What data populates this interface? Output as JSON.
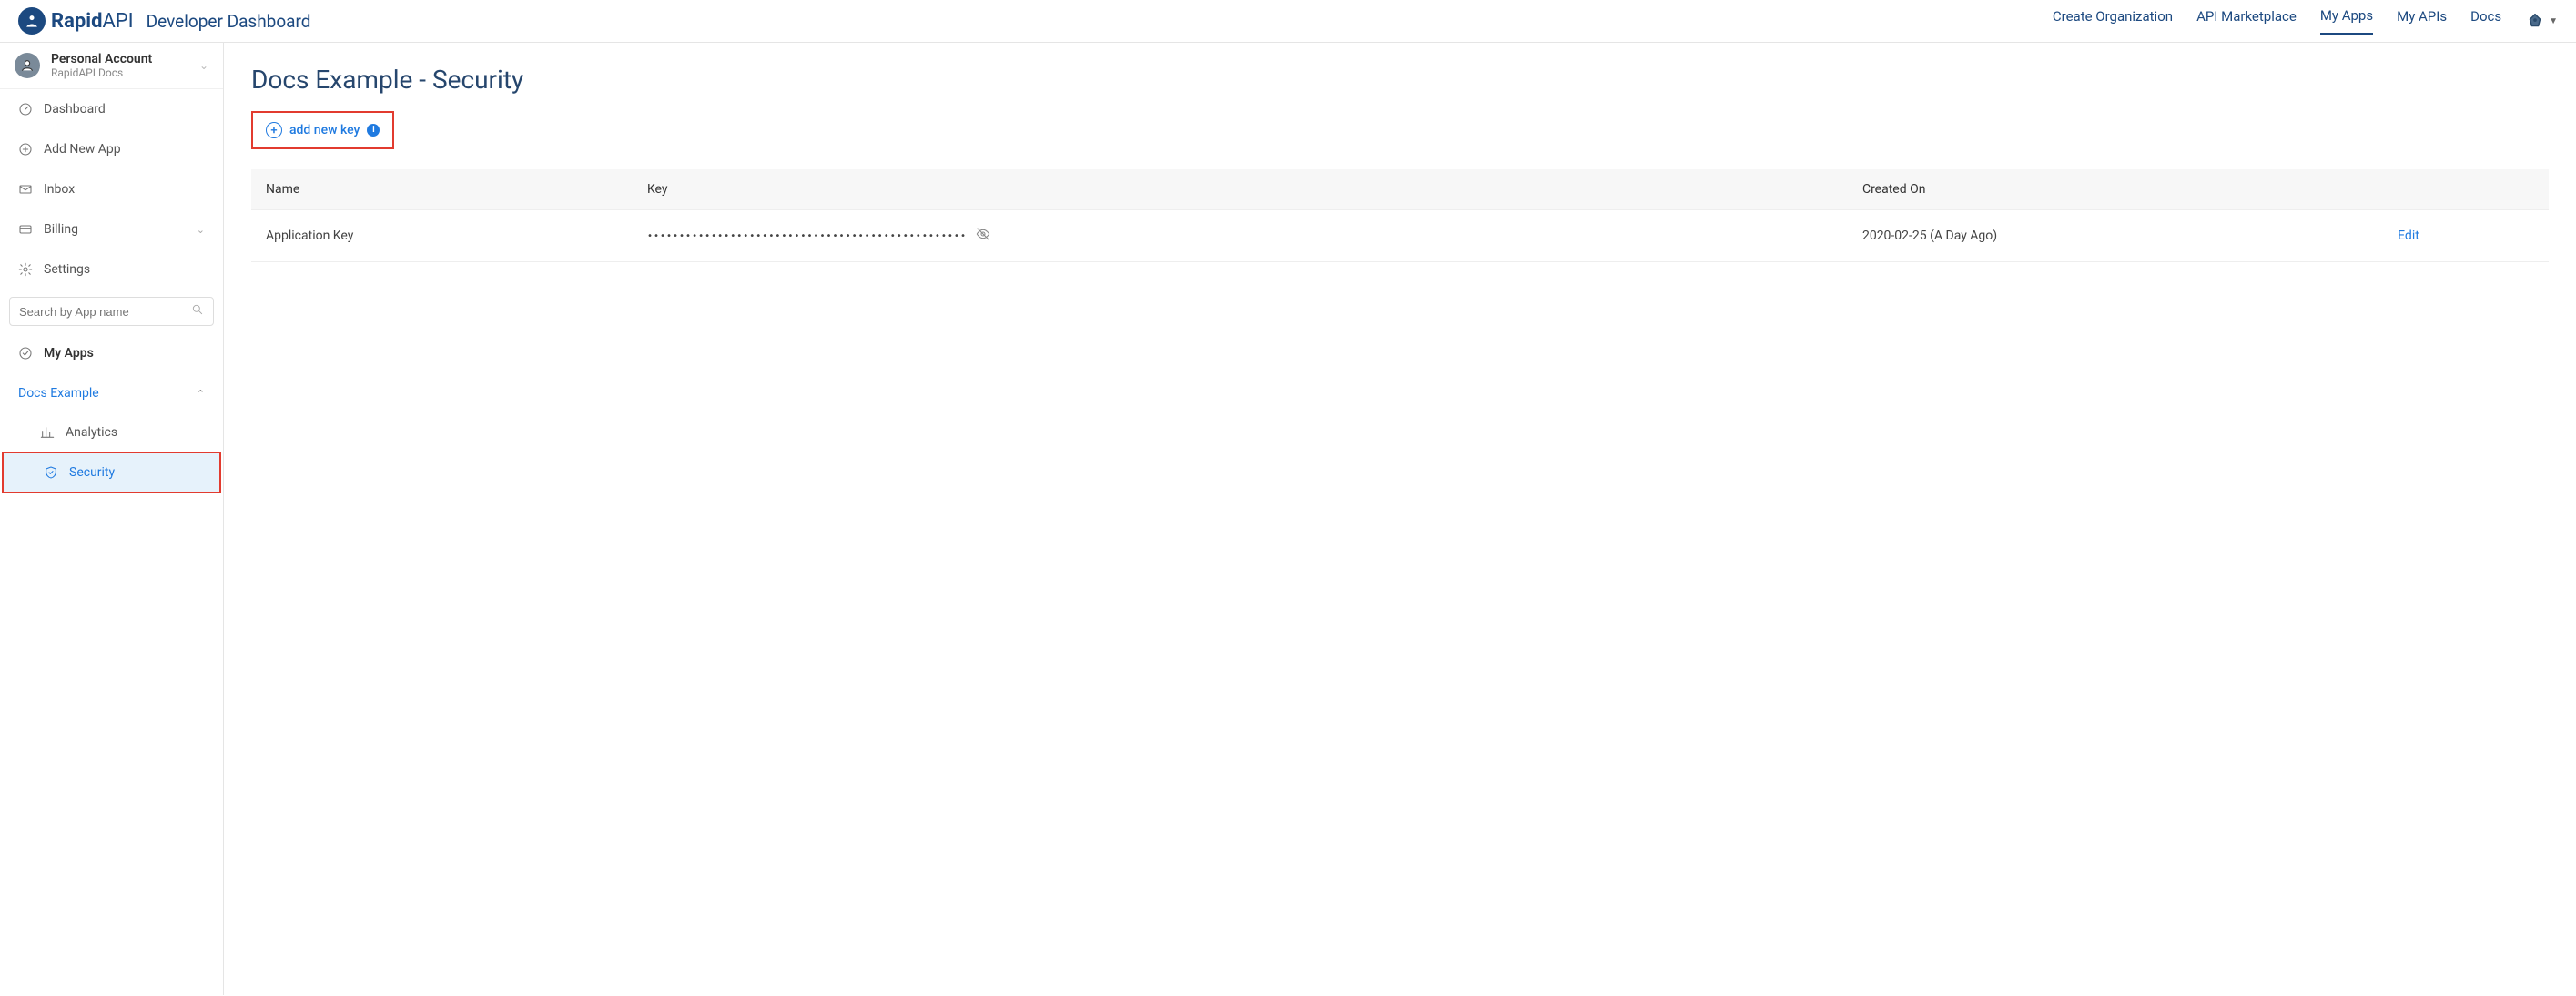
{
  "header": {
    "brand_primary": "Rapid",
    "brand_secondary": "API",
    "title": "Developer Dashboard",
    "nav": {
      "create_org": "Create Organization",
      "marketplace": "API Marketplace",
      "my_apps": "My Apps",
      "my_apis": "My APIs",
      "docs": "Docs"
    }
  },
  "sidebar": {
    "account": {
      "name": "Personal Account",
      "sub": "RapidAPI Docs"
    },
    "items": {
      "dashboard": "Dashboard",
      "add_app": "Add New App",
      "inbox": "Inbox",
      "billing": "Billing",
      "settings": "Settings"
    },
    "search_placeholder": "Search by App name",
    "my_apps_label": "My Apps",
    "app_group": {
      "name": "Docs Example",
      "analytics": "Analytics",
      "security": "Security"
    }
  },
  "main": {
    "title": "Docs Example - Security",
    "add_key_label": "add new key",
    "table": {
      "headers": {
        "name": "Name",
        "key": "Key",
        "created": "Created On"
      },
      "rows": [
        {
          "name": "Application Key",
          "key_masked": "••••••••••••••••••••••••••••••••••••••••••••••••••",
          "created": "2020-02-25 (A Day Ago)",
          "edit": "Edit"
        }
      ]
    }
  }
}
